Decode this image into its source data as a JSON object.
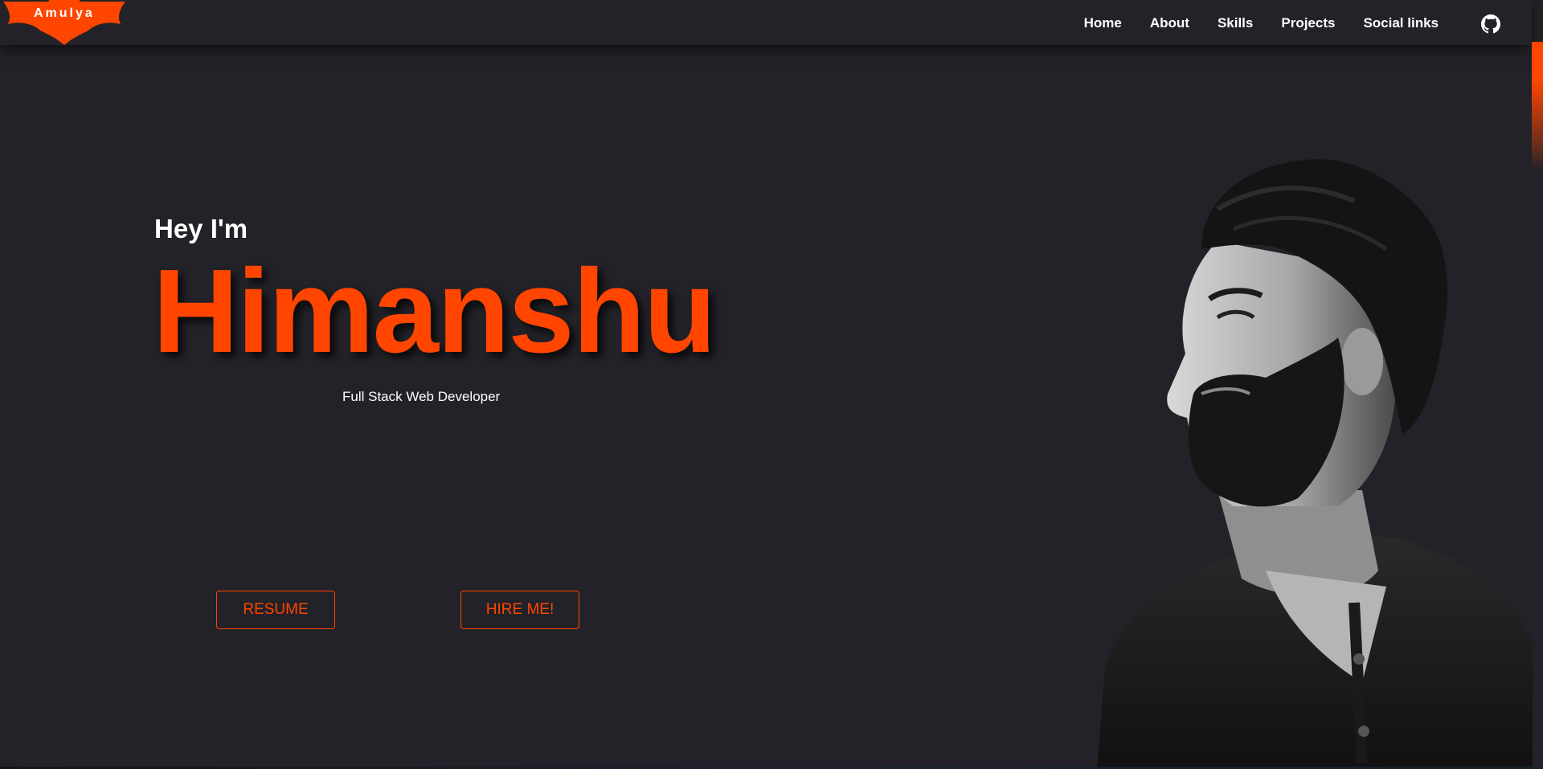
{
  "brand": {
    "logo_text": "Amulya",
    "accent_color": "#ff4500",
    "background_color": "#232228"
  },
  "nav": {
    "items": [
      "Home",
      "About",
      "Skills",
      "Projects",
      "Social links"
    ],
    "github_icon": "github-icon"
  },
  "hero": {
    "greeting": "Hey I'm",
    "name": "Himanshu",
    "role": "Full Stack Web Developer",
    "resume_label": "RESUME",
    "hire_label": "HIRE ME!"
  },
  "portrait": {
    "icon": "person-portrait"
  }
}
